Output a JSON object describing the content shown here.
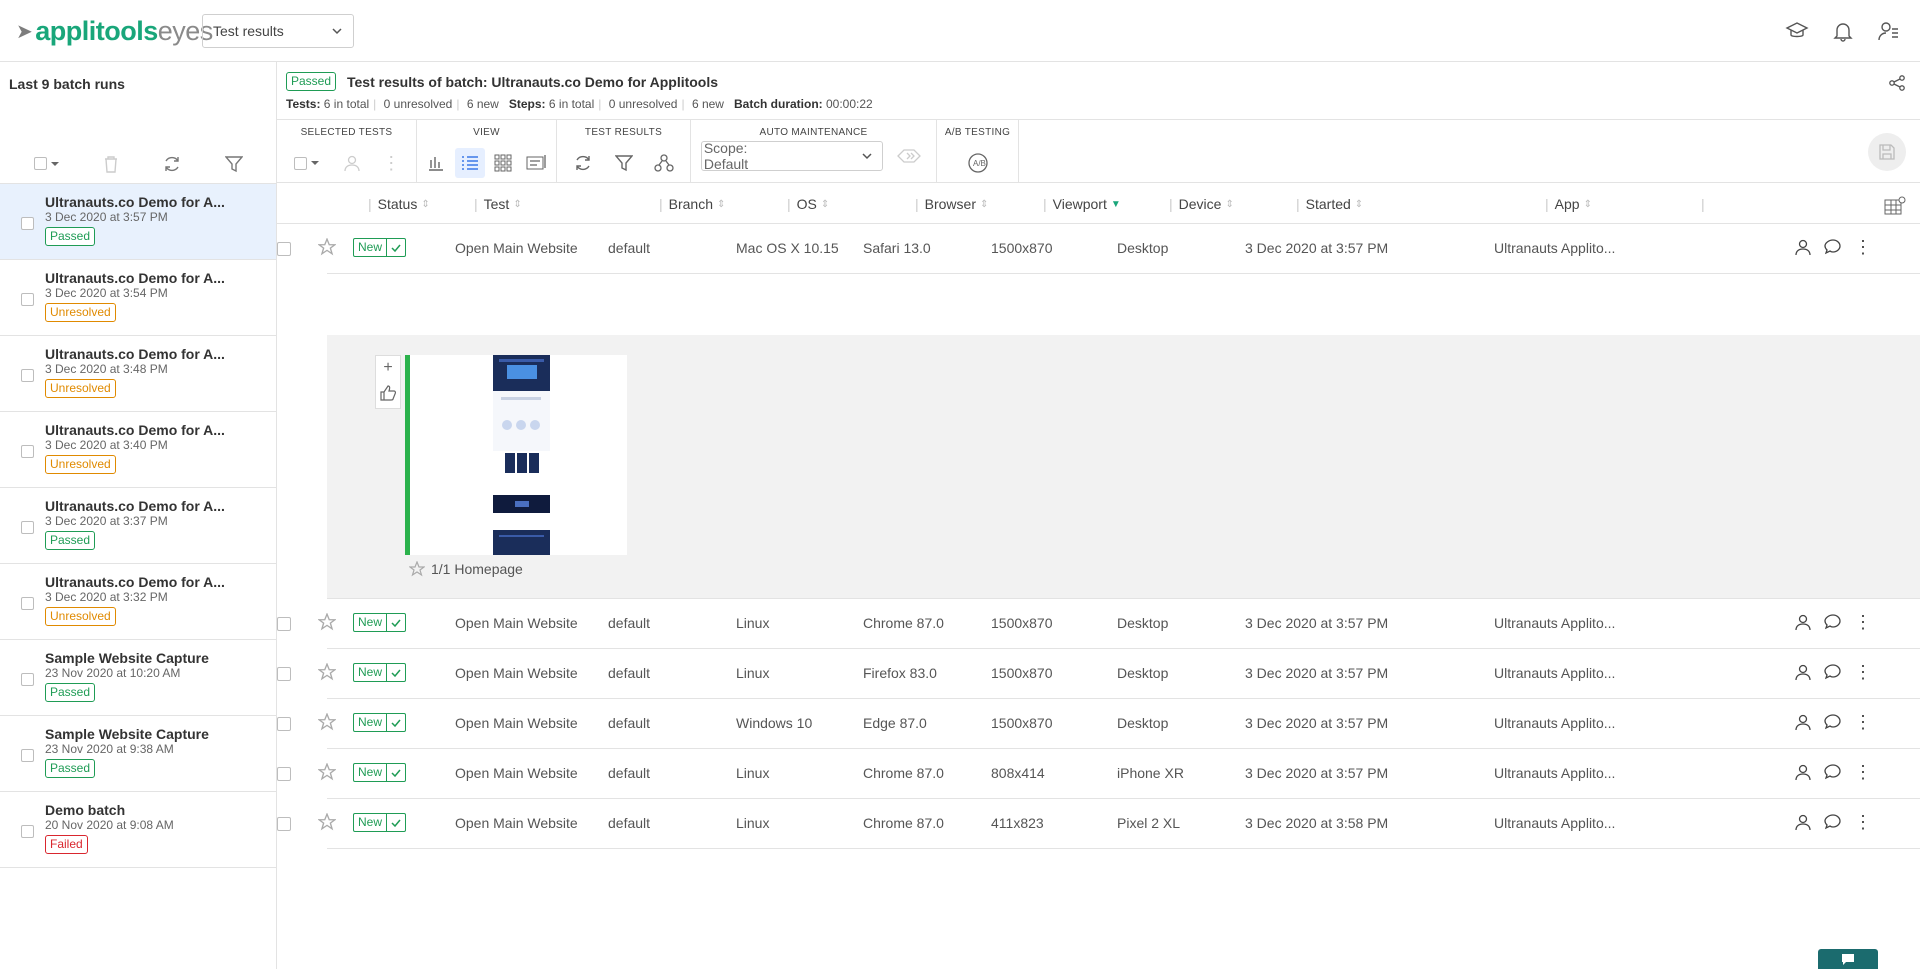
{
  "header": {
    "logo_brand": "applitools",
    "logo_suffix": "eyes",
    "view_select": "Test results"
  },
  "sidebar": {
    "title": "Last 9 batch runs",
    "batches": [
      {
        "name": "Ultranauts.co Demo for A...",
        "date": "3 Dec 2020 at 3:57 PM",
        "status": "Passed",
        "status_type": "passed"
      },
      {
        "name": "Ultranauts.co Demo for A...",
        "date": "3 Dec 2020 at 3:54 PM",
        "status": "Unresolved",
        "status_type": "unresolved"
      },
      {
        "name": "Ultranauts.co Demo for A...",
        "date": "3 Dec 2020 at 3:48 PM",
        "status": "Unresolved",
        "status_type": "unresolved"
      },
      {
        "name": "Ultranauts.co Demo for A...",
        "date": "3 Dec 2020 at 3:40 PM",
        "status": "Unresolved",
        "status_type": "unresolved"
      },
      {
        "name": "Ultranauts.co Demo for A...",
        "date": "3 Dec 2020 at 3:37 PM",
        "status": "Passed",
        "status_type": "passed"
      },
      {
        "name": "Ultranauts.co Demo for A...",
        "date": "3 Dec 2020 at 3:32 PM",
        "status": "Unresolved",
        "status_type": "unresolved"
      },
      {
        "name": "Sample Website Capture",
        "date": "23 Nov 2020 at 10:20 AM",
        "status": "Passed",
        "status_type": "passed"
      },
      {
        "name": "Sample Website Capture",
        "date": "23 Nov 2020 at 9:38 AM",
        "status": "Passed",
        "status_type": "passed"
      },
      {
        "name": "Demo batch",
        "date": "20 Nov 2020 at 9:08 AM",
        "status": "Failed",
        "status_type": "failed"
      }
    ]
  },
  "batch_header": {
    "status": "Passed",
    "title": "Test results of batch: Ultranauts.co Demo for Applitools",
    "tests_label": "Tests:",
    "tests_total": "6 in total",
    "tests_unresolved": "0 unresolved",
    "tests_new": "6 new",
    "steps_label": "Steps:",
    "steps_total": "6 in total",
    "steps_unresolved": "0 unresolved",
    "steps_new": "6 new",
    "duration_label": "Batch duration:",
    "duration": "00:00:22"
  },
  "toolbar": {
    "selected_tests": "SELECTED TESTS",
    "view": "VIEW",
    "test_results": "TEST RESULTS",
    "auto_maintenance": "AUTO MAINTENANCE",
    "ab_testing": "A/B TESTING",
    "scope": "Scope: Default"
  },
  "columns": [
    "Status",
    "Test",
    "Branch",
    "OS",
    "Browser",
    "Viewport",
    "Device",
    "Started",
    "App"
  ],
  "rows": [
    {
      "status": "New",
      "test": "Open Main Website",
      "branch": "default",
      "os": "Mac OS X 10.15",
      "browser": "Safari 13.0",
      "viewport": "1500x870",
      "device": "Desktop",
      "started": "3 Dec 2020 at 3:57 PM",
      "app": "Ultranauts Applito..."
    },
    {
      "status": "New",
      "test": "Open Main Website",
      "branch": "default",
      "os": "Linux",
      "browser": "Chrome 87.0",
      "viewport": "1500x870",
      "device": "Desktop",
      "started": "3 Dec 2020 at 3:57 PM",
      "app": "Ultranauts Applito..."
    },
    {
      "status": "New",
      "test": "Open Main Website",
      "branch": "default",
      "os": "Linux",
      "browser": "Firefox 83.0",
      "viewport": "1500x870",
      "device": "Desktop",
      "started": "3 Dec 2020 at 3:57 PM",
      "app": "Ultranauts Applito..."
    },
    {
      "status": "New",
      "test": "Open Main Website",
      "branch": "default",
      "os": "Windows 10",
      "browser": "Edge 87.0",
      "viewport": "1500x870",
      "device": "Desktop",
      "started": "3 Dec 2020 at 3:57 PM",
      "app": "Ultranauts Applito..."
    },
    {
      "status": "New",
      "test": "Open Main Website",
      "branch": "default",
      "os": "Linux",
      "browser": "Chrome 87.0",
      "viewport": "808x414",
      "device": "iPhone XR",
      "started": "3 Dec 2020 at 3:57 PM",
      "app": "Ultranauts Applito..."
    },
    {
      "status": "New",
      "test": "Open Main Website",
      "branch": "default",
      "os": "Linux",
      "browser": "Chrome 87.0",
      "viewport": "411x823",
      "device": "Pixel 2 XL",
      "started": "3 Dec 2020 at 3:58 PM",
      "app": "Ultranauts Applito..."
    }
  ],
  "expanded_step": {
    "caption": "1/1 Homepage"
  },
  "colors": {
    "brand": "#19a67a",
    "passed": "#1f9c55",
    "unresolved": "#e08a00",
    "failed": "#d9262e",
    "selected_row": "#e8f1fd"
  }
}
